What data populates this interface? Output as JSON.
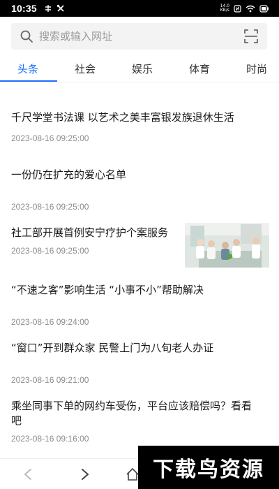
{
  "status_bar": {
    "time": "10:35",
    "net_speed_value": "14.0",
    "net_speed_unit": "KB/s"
  },
  "search": {
    "placeholder": "搜索或输入网址",
    "icons": [
      "search-icon",
      "scan-icon"
    ]
  },
  "tabs": [
    {
      "label": "头条",
      "active": true
    },
    {
      "label": "社会",
      "active": false
    },
    {
      "label": "娱乐",
      "active": false
    },
    {
      "label": "体育",
      "active": false
    },
    {
      "label": "时尚",
      "active": false
    }
  ],
  "news": [
    {
      "title": "千尺学堂书法课 以艺术之美丰富银发族退休生活",
      "time": "2023-08-16 09:25:00"
    },
    {
      "title": "一份仍在扩充的爱心名单",
      "time": "2023-08-16 09:25:00"
    },
    {
      "title": "社工部开展首例安宁疗护个案服务",
      "time": "2023-08-16 09:25:00"
    },
    {
      "title": "“不速之客”影响生活 “小事不小”帮助解决",
      "time": "2023-08-16 09:24:00"
    },
    {
      "title": "“窗口”开到群众家 民警上门为八旬老人办证",
      "time": "2023-08-16 09:21:00"
    },
    {
      "title": "乘坐同事下单的网约车受伤，平台应该赔偿吗？看看吧",
      "time": "2023-08-16 09:16:00"
    }
  ],
  "bottom_nav": {
    "icons": [
      "back-icon",
      "forward-icon",
      "home-icon"
    ]
  },
  "watermark": {
    "text": "下载鸟资源"
  },
  "colors": {
    "accent": "#1e6fff",
    "time_text": "#8c8c8c",
    "search_bg": "#f3f3f3"
  }
}
